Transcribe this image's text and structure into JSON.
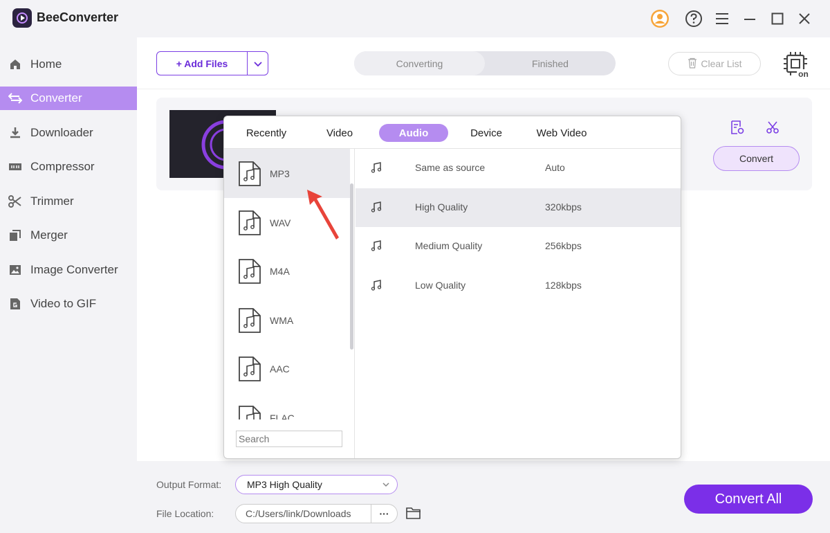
{
  "app": {
    "title": "BeeConverter"
  },
  "titlebar": {
    "icons": [
      "user-avatar-icon",
      "help-icon",
      "menu-icon",
      "minimize-icon",
      "maximize-icon",
      "close-icon"
    ]
  },
  "sidebar": {
    "items": [
      {
        "label": "Home",
        "icon": "home-icon"
      },
      {
        "label": "Converter",
        "icon": "converter-icon",
        "active": true
      },
      {
        "label": "Downloader",
        "icon": "download-icon"
      },
      {
        "label": "Compressor",
        "icon": "compressor-icon"
      },
      {
        "label": "Trimmer",
        "icon": "scissors-icon"
      },
      {
        "label": "Merger",
        "icon": "merger-icon"
      },
      {
        "label": "Image Converter",
        "icon": "image-icon"
      },
      {
        "label": "Video to GIF",
        "icon": "gif-icon"
      }
    ]
  },
  "toolbar": {
    "add_files": "+ Add Files",
    "tabs": [
      "Converting",
      "Finished"
    ],
    "active_tab": "Converting",
    "clear_list": "Clear List"
  },
  "file_card": {
    "convert": "Convert"
  },
  "popup": {
    "tabs": [
      "Recently",
      "Video",
      "Audio",
      "Device",
      "Web Video"
    ],
    "active_tab": "Audio",
    "formats": [
      "MP3",
      "WAV",
      "M4A",
      "WMA",
      "AAC",
      "FLAC"
    ],
    "selected_format": "MP3",
    "search_placeholder": "Search",
    "qualities": [
      {
        "name": "Same as source",
        "bitrate": "Auto"
      },
      {
        "name": "High Quality",
        "bitrate": "320kbps",
        "selected": true
      },
      {
        "name": "Medium Quality",
        "bitrate": "256kbps"
      },
      {
        "name": "Low Quality",
        "bitrate": "128kbps"
      }
    ]
  },
  "bottom": {
    "output_format_label": "Output Format:",
    "output_format_value": "MP3 High Quality",
    "file_location_label": "File Location:",
    "file_location_value": "C:/Users/link/Downloads",
    "more": "···",
    "convert_all": "Convert All"
  },
  "colors": {
    "accent": "#7b2fe8",
    "sidebar_active": "#b58cf0",
    "annotation_arrow": "#e8443a"
  }
}
